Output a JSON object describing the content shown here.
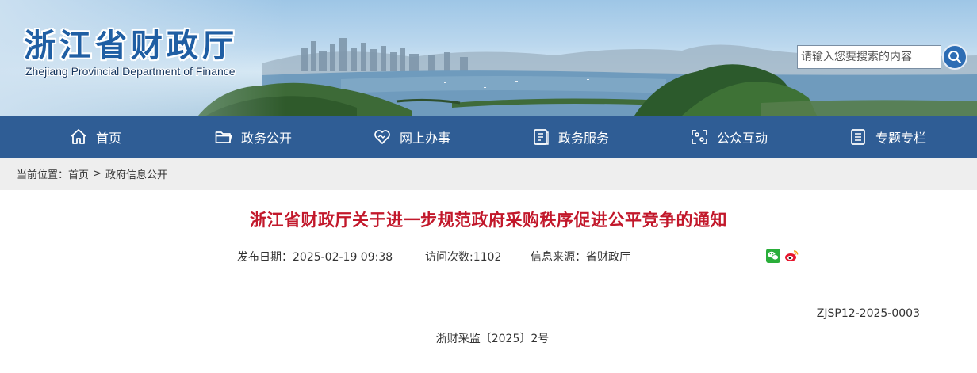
{
  "site": {
    "name_cn": "浙江省财政厅",
    "name_en": "Zhejiang Provincial Department of Finance",
    "search_placeholder": "请输入您要搜索的内容"
  },
  "nav": [
    {
      "label": "首页",
      "icon": "home-icon"
    },
    {
      "label": "政务公开",
      "icon": "folder-icon"
    },
    {
      "label": "网上办事",
      "icon": "handshake-heart-icon"
    },
    {
      "label": "政务服务",
      "icon": "document-icon"
    },
    {
      "label": "公众互动",
      "icon": "interaction-icon"
    },
    {
      "label": "专题专栏",
      "icon": "list-icon"
    }
  ],
  "breadcrumb": {
    "prefix": "当前位置：",
    "items": [
      "首页",
      "政府信息公开"
    ],
    "separator": ">"
  },
  "article": {
    "title": "浙江省财政厅关于进一步规范政府采购秩序促进公平竞争的通知",
    "publish_label": "发布日期：",
    "publish_date": "2025-02-19 09:38",
    "visits_label": "访问次数:",
    "visits": "1102",
    "source_label": "信息来源：",
    "source": "省财政厅",
    "share_icons": [
      "wechat-icon",
      "weibo-icon"
    ],
    "doc_code": "ZJSP12-2025-0003",
    "doc_number": "浙财采监〔2025〕2号"
  },
  "colors": {
    "nav_bg": "#2f5d95",
    "title_red": "#c2182b",
    "logo_blue": "#1f5ea3"
  }
}
